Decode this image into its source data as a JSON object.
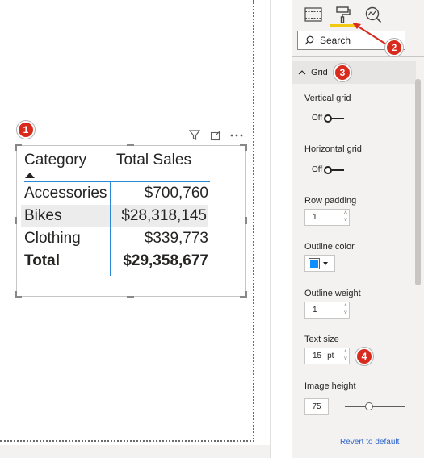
{
  "table": {
    "headers": [
      "Category",
      "Total Sales"
    ],
    "rows": [
      {
        "category": "Accessories",
        "sales": "$700,760"
      },
      {
        "category": "Bikes",
        "sales": "$28,318,145"
      },
      {
        "category": "Clothing",
        "sales": "$339,773"
      }
    ],
    "total": {
      "label": "Total",
      "value": "$29,358,677"
    }
  },
  "format_pane": {
    "search_placeholder": "Search",
    "section": "Grid",
    "vertical_grid": {
      "label": "Vertical grid",
      "state": "Off"
    },
    "horizontal_grid": {
      "label": "Horizontal grid",
      "state": "Off"
    },
    "row_padding": {
      "label": "Row padding",
      "value": "1"
    },
    "outline_color": {
      "label": "Outline color",
      "color": "#118dff"
    },
    "outline_weight": {
      "label": "Outline weight",
      "value": "1"
    },
    "text_size": {
      "label": "Text size",
      "value": "15",
      "unit": "pt"
    },
    "image_height": {
      "label": "Image height",
      "value": "75"
    },
    "revert": "Revert to default"
  },
  "callouts": [
    "1",
    "2",
    "3",
    "4"
  ],
  "colors": {
    "accent": "#2b88d8",
    "tab_underline": "#f2c811",
    "callout": "#d92a1e"
  }
}
